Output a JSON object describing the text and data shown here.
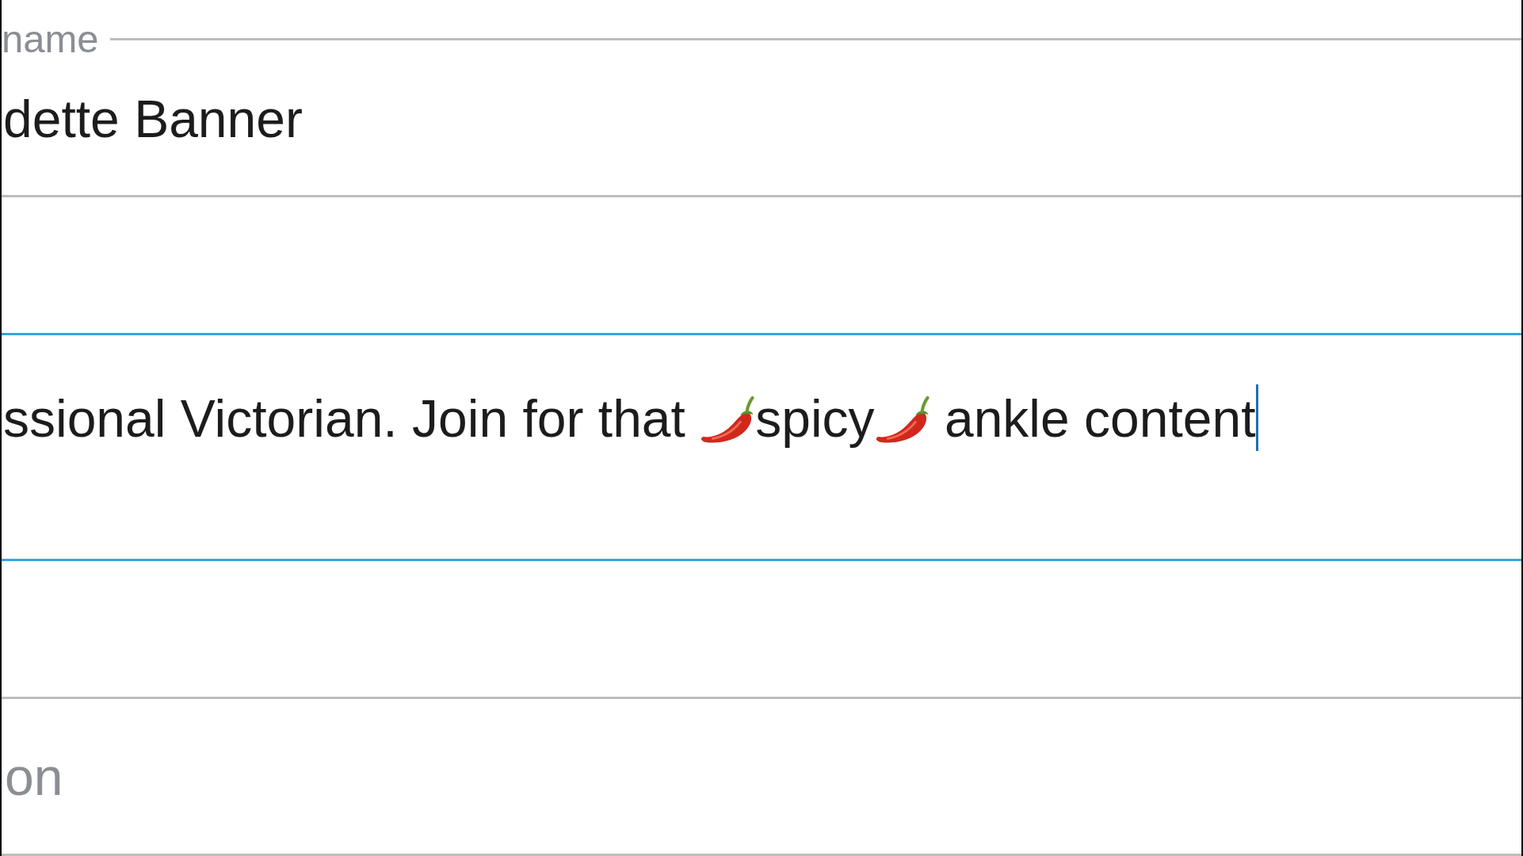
{
  "section": {
    "header": "name"
  },
  "fields": [
    {
      "kind": "underlined",
      "focused": false,
      "value": "dette Banner"
    },
    {
      "kind": "multiline",
      "focused": true,
      "value_parts": [
        {
          "kind": "text",
          "text": "ssional Victorian. Join for that "
        },
        {
          "kind": "icon"
        },
        {
          "kind": "text",
          "text": "spicy"
        },
        {
          "kind": "icon"
        },
        {
          "kind": "text",
          "text": " ankle content"
        }
      ]
    },
    {
      "kind": "boxed",
      "focused": false,
      "placeholder": "on"
    }
  ]
}
